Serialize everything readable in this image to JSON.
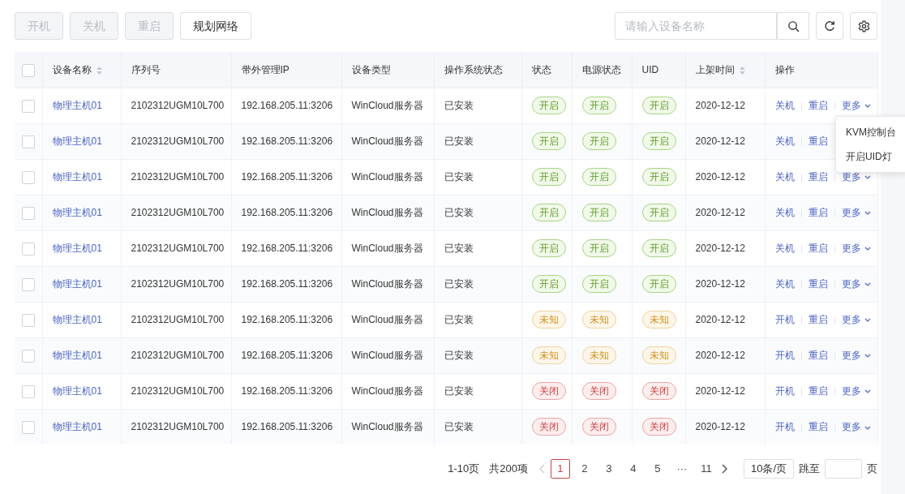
{
  "toolbar": {
    "buttons": [
      {
        "label": "开机",
        "disabled": true
      },
      {
        "label": "关机",
        "disabled": true
      },
      {
        "label": "重启",
        "disabled": true
      },
      {
        "label": "规划网络",
        "disabled": false
      }
    ],
    "search": {
      "placeholder": "请输入设备名称"
    }
  },
  "table": {
    "select_all": {
      "checked": false
    },
    "columns": [
      {
        "label": "设备名称",
        "sortable": true
      },
      {
        "label": "序列号",
        "sortable": false
      },
      {
        "label": "带外管理IP",
        "sortable": false
      },
      {
        "label": "设备类型",
        "sortable": false
      },
      {
        "label": "操作系统状态",
        "sortable": false
      },
      {
        "label": "状态",
        "sortable": false
      },
      {
        "label": "电源状态",
        "sortable": false
      },
      {
        "label": "UID",
        "sortable": false
      },
      {
        "label": "上架时间",
        "sortable": true
      },
      {
        "label": "操作",
        "sortable": false
      }
    ],
    "rows": [
      {
        "checked": false,
        "name": "物理主机01",
        "serial": "2102312UGM10L700",
        "ip": "192.168.205.11:3206",
        "type": "WinCloud服务器",
        "os": "已安装",
        "status": {
          "label": "开启",
          "kind": "on"
        },
        "power": {
          "label": "开启",
          "kind": "on"
        },
        "uid": {
          "label": "开启",
          "kind": "on"
        },
        "time": "2020-12-12",
        "actions": [
          "关机",
          "重启",
          "更多"
        ]
      },
      {
        "checked": false,
        "name": "物理主机01",
        "serial": "2102312UGM10L700",
        "ip": "192.168.205.11:3206",
        "type": "WinCloud服务器",
        "os": "已安装",
        "status": {
          "label": "开启",
          "kind": "on"
        },
        "power": {
          "label": "开启",
          "kind": "on"
        },
        "uid": {
          "label": "开启",
          "kind": "on"
        },
        "time": "2020-12-12",
        "actions": [
          "关机",
          "重启"
        ]
      },
      {
        "checked": false,
        "name": "物理主机01",
        "serial": "2102312UGM10L700",
        "ip": "192.168.205.11:3206",
        "type": "WinCloud服务器",
        "os": "已安装",
        "status": {
          "label": "开启",
          "kind": "on"
        },
        "power": {
          "label": "开启",
          "kind": "on"
        },
        "uid": {
          "label": "开启",
          "kind": "on"
        },
        "time": "2020-12-12",
        "actions": [
          "关机",
          "重启",
          "更多"
        ]
      },
      {
        "checked": false,
        "name": "物理主机01",
        "serial": "2102312UGM10L700",
        "ip": "192.168.205.11:3206",
        "type": "WinCloud服务器",
        "os": "已安装",
        "status": {
          "label": "开启",
          "kind": "on"
        },
        "power": {
          "label": "开启",
          "kind": "on"
        },
        "uid": {
          "label": "开启",
          "kind": "on"
        },
        "time": "2020-12-12",
        "actions": [
          "关机",
          "重启",
          "更多"
        ]
      },
      {
        "checked": false,
        "name": "物理主机01",
        "serial": "2102312UGM10L700",
        "ip": "192.168.205.11:3206",
        "type": "WinCloud服务器",
        "os": "已安装",
        "status": {
          "label": "开启",
          "kind": "on"
        },
        "power": {
          "label": "开启",
          "kind": "on"
        },
        "uid": {
          "label": "开启",
          "kind": "on"
        },
        "time": "2020-12-12",
        "actions": [
          "关机",
          "重启",
          "更多"
        ]
      },
      {
        "checked": false,
        "name": "物理主机01",
        "serial": "2102312UGM10L700",
        "ip": "192.168.205.11:3206",
        "type": "WinCloud服务器",
        "os": "已安装",
        "status": {
          "label": "开启",
          "kind": "on"
        },
        "power": {
          "label": "开启",
          "kind": "on"
        },
        "uid": {
          "label": "开启",
          "kind": "on"
        },
        "time": "2020-12-12",
        "actions": [
          "关机",
          "重启",
          "更多"
        ]
      },
      {
        "checked": false,
        "name": "物理主机01",
        "serial": "2102312UGM10L700",
        "ip": "192.168.205.11:3206",
        "type": "WinCloud服务器",
        "os": "已安装",
        "status": {
          "label": "未知",
          "kind": "unknown"
        },
        "power": {
          "label": "未知",
          "kind": "unknown"
        },
        "uid": {
          "label": "未知",
          "kind": "unknown"
        },
        "time": "2020-12-12",
        "actions": [
          "开机",
          "重启",
          "更多"
        ]
      },
      {
        "checked": false,
        "name": "物理主机01",
        "serial": "2102312UGM10L700",
        "ip": "192.168.205.11:3206",
        "type": "WinCloud服务器",
        "os": "已安装",
        "status": {
          "label": "未知",
          "kind": "unknown"
        },
        "power": {
          "label": "未知",
          "kind": "unknown"
        },
        "uid": {
          "label": "未知",
          "kind": "unknown"
        },
        "time": "2020-12-12",
        "actions": [
          "开机",
          "重启",
          "更多"
        ]
      },
      {
        "checked": false,
        "name": "物理主机01",
        "serial": "2102312UGM10L700",
        "ip": "192.168.205.11:3206",
        "type": "WinCloud服务器",
        "os": "已安装",
        "status": {
          "label": "关闭",
          "kind": "off"
        },
        "power": {
          "label": "关闭",
          "kind": "off"
        },
        "uid": {
          "label": "关闭",
          "kind": "off"
        },
        "time": "2020-12-12",
        "actions": [
          "开机",
          "重启",
          "更多"
        ]
      },
      {
        "checked": false,
        "name": "物理主机01",
        "serial": "2102312UGM10L700",
        "ip": "192.168.205.11:3206",
        "type": "WinCloud服务器",
        "os": "已安装",
        "status": {
          "label": "关闭",
          "kind": "off"
        },
        "power": {
          "label": "关闭",
          "kind": "off"
        },
        "uid": {
          "label": "关闭",
          "kind": "off"
        },
        "time": "2020-12-12",
        "actions": [
          "开机",
          "重启",
          "更多"
        ]
      }
    ]
  },
  "dropdown_menu": {
    "items": [
      "KVM控制台",
      "开启UID灯"
    ]
  },
  "pagination": {
    "range": "1-10页",
    "total": "共200项",
    "prev_disabled": true,
    "pages": [
      {
        "label": "1",
        "selected": true
      },
      {
        "label": "2",
        "selected": false
      },
      {
        "label": "3",
        "selected": false
      },
      {
        "label": "4",
        "selected": false
      },
      {
        "label": "5",
        "selected": false
      },
      {
        "label": "···",
        "selected": false
      },
      {
        "label": "11",
        "selected": false
      }
    ],
    "page_size": "10条/页",
    "jump_label": "跳至",
    "jump_suffix": "页"
  }
}
